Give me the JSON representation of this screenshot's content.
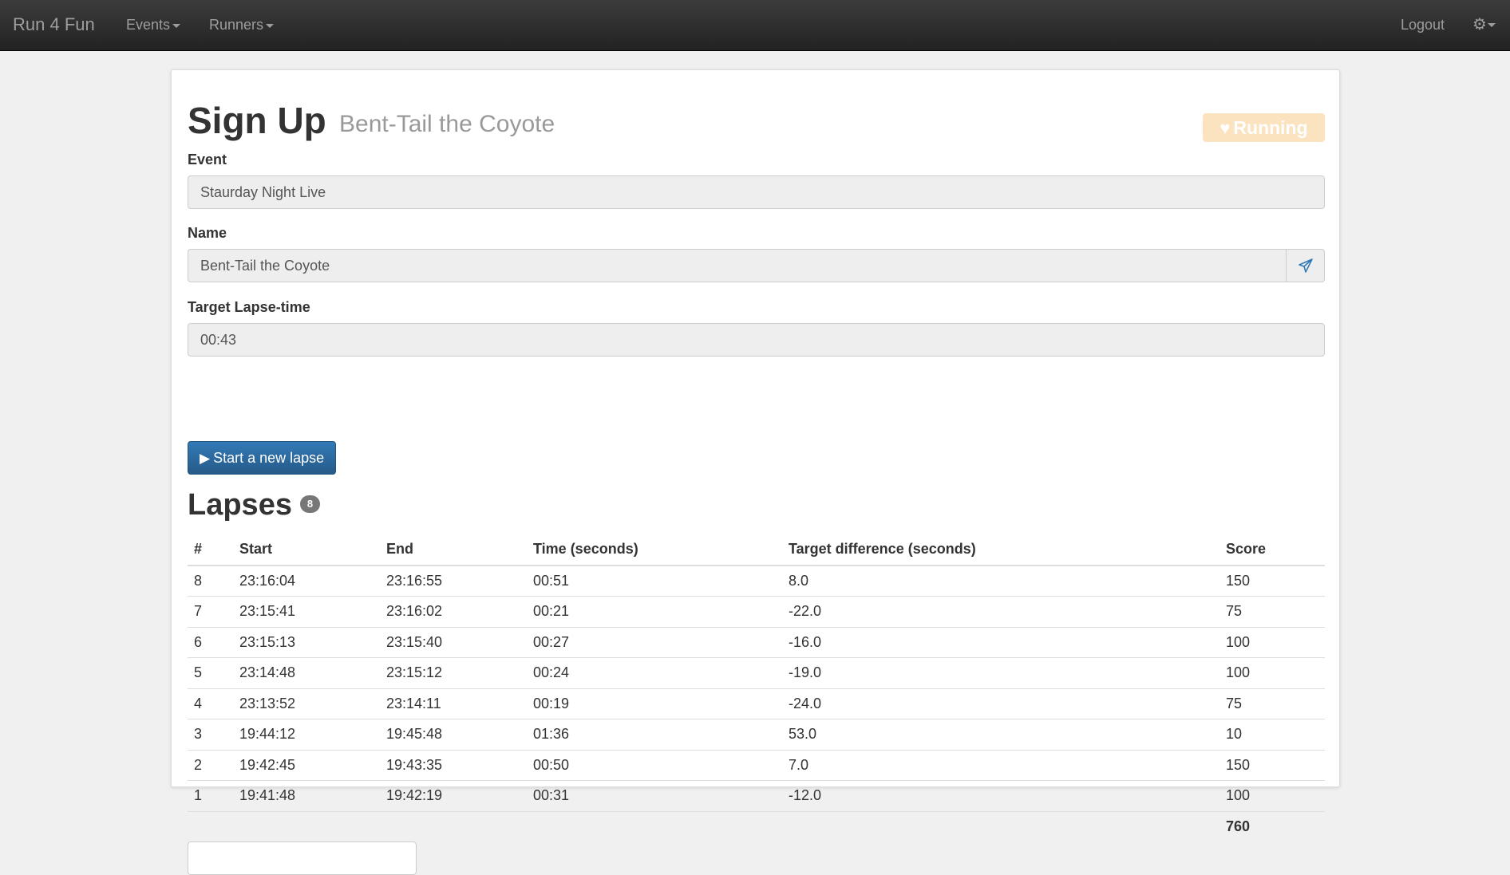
{
  "navbar": {
    "brand": "Run 4 Fun",
    "events_label": "Events",
    "runners_label": "Runners",
    "logout_label": "Logout"
  },
  "header": {
    "title": "Sign Up",
    "subtitle": "Bent-Tail the Coyote",
    "status": "Running",
    "status_color": "#fbe3c0"
  },
  "form": {
    "event_label": "Event",
    "event_value": "Staurday Night Live",
    "name_label": "Name",
    "name_value": "Bent-Tail the Coyote",
    "target_label": "Target Lapse-time",
    "target_value": "00:43",
    "start_button": "Start a new lapse"
  },
  "lapses": {
    "title": "Lapses",
    "count": "8",
    "columns": [
      "#",
      "Start",
      "End",
      "Time (seconds)",
      "Target difference (seconds)",
      "Score"
    ],
    "rows": [
      [
        "8",
        "23:16:04",
        "23:16:55",
        "00:51",
        "8.0",
        "150"
      ],
      [
        "7",
        "23:15:41",
        "23:16:02",
        "00:21",
        "-22.0",
        "75"
      ],
      [
        "6",
        "23:15:13",
        "23:15:40",
        "00:27",
        "-16.0",
        "100"
      ],
      [
        "5",
        "23:14:48",
        "23:15:12",
        "00:24",
        "-19.0",
        "100"
      ],
      [
        "4",
        "23:13:52",
        "23:14:11",
        "00:19",
        "-24.0",
        "75"
      ],
      [
        "3",
        "19:44:12",
        "19:45:48",
        "01:36",
        "53.0",
        "10"
      ],
      [
        "2",
        "19:42:45",
        "19:43:35",
        "00:50",
        "7.0",
        "150"
      ],
      [
        "1",
        "19:41:48",
        "19:42:19",
        "00:31",
        "-12.0",
        "100"
      ]
    ],
    "total_score": "760"
  },
  "colors": {
    "navbar": "#222222",
    "primary": "#337ab7"
  }
}
